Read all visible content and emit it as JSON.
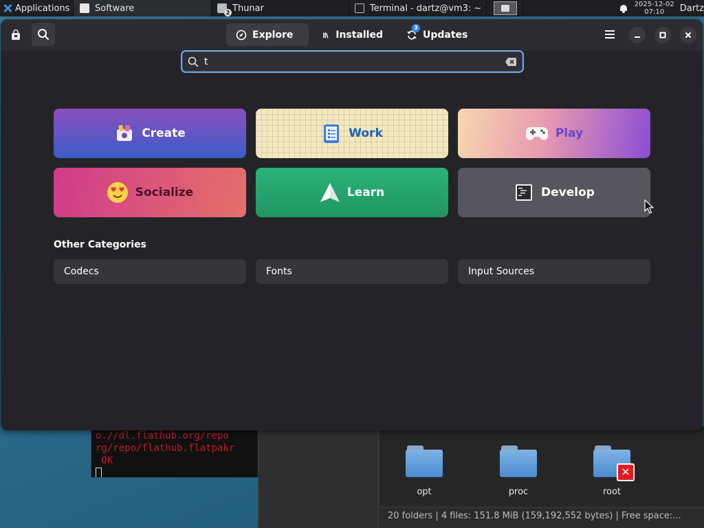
{
  "panel": {
    "apps_label": "Applications",
    "tasks": [
      {
        "label": "Software"
      },
      {
        "label": "Thunar",
        "badge": "2"
      },
      {
        "label": "Terminal - dartz@vm3: ~"
      }
    ],
    "clock_date": "2025-12-02",
    "clock_time": "07:10",
    "user": "Dartz"
  },
  "window": {
    "tabs": [
      {
        "label": "Explore"
      },
      {
        "label": "Installed"
      },
      {
        "label": "Updates",
        "badge": "3"
      }
    ],
    "search": {
      "value": "t",
      "placeholder": ""
    },
    "categories": [
      {
        "label": "Create"
      },
      {
        "label": "Work"
      },
      {
        "label": "Play"
      },
      {
        "label": "Socialize"
      },
      {
        "label": "Learn"
      },
      {
        "label": "Develop"
      }
    ],
    "other_title": "Other Categories",
    "other": [
      {
        "label": "Codecs"
      },
      {
        "label": "Fonts"
      },
      {
        "label": "Input Sources"
      }
    ]
  },
  "terminal": {
    "lines": [
      "o.//dl.flathub.org/repo",
      "rg/repo/flathub.flatpakr",
      " OK"
    ]
  },
  "thunar": {
    "folders": [
      {
        "label": "opt"
      },
      {
        "label": "proc"
      },
      {
        "label": "root"
      }
    ],
    "status": "20 folders  |  4 files: 151.8 MiB (159,192,552 bytes)  |  Free space:..."
  },
  "colors": {
    "accent": "#7ba3d9",
    "window_bg": "#242428",
    "header_bg": "#2c2c30"
  }
}
